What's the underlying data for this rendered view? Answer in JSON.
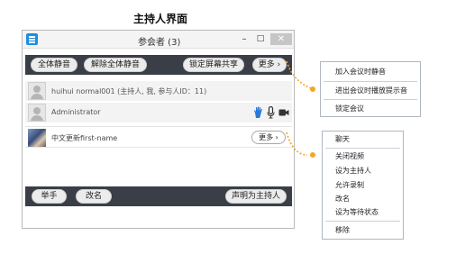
{
  "page_title": "主持人界面",
  "window": {
    "title": "参会者 (3)",
    "min_glyph": "–",
    "max_glyph": "□",
    "close_glyph": "✕"
  },
  "toolbar_top": {
    "mute_all": "全体静音",
    "unmute_all": "解除全体静音",
    "lock_screen_share": "锁定屏幕共享",
    "more": "更多 ›"
  },
  "participants": [
    {
      "name": "huihui normal001",
      "detail": "(主持人, 我, 参与人ID：11)"
    },
    {
      "name": "Administrator",
      "icons": [
        "raise-hand-icon",
        "microphone-icon",
        "camera-icon"
      ]
    },
    {
      "name": "中文更新first-name",
      "more": "更多 ›"
    }
  ],
  "toolbar_bottom": {
    "raise_hand": "举手",
    "rename": "改名",
    "claim_host": "声明为主持人"
  },
  "menu_top": {
    "items": [
      "加入会议时静音",
      "进出会议时播放提示音",
      "锁定会议"
    ]
  },
  "menu_participant": {
    "items": [
      "聊天",
      "关闭视频",
      "设为主持人",
      "允许录制",
      "改名",
      "设为等待状态",
      "移除"
    ]
  },
  "colors": {
    "toolbar_bg": "#3a3f47",
    "accent_blue": "#1d8fdc",
    "leader_orange": "#f5a623",
    "hand_blue": "#2a78d6"
  }
}
